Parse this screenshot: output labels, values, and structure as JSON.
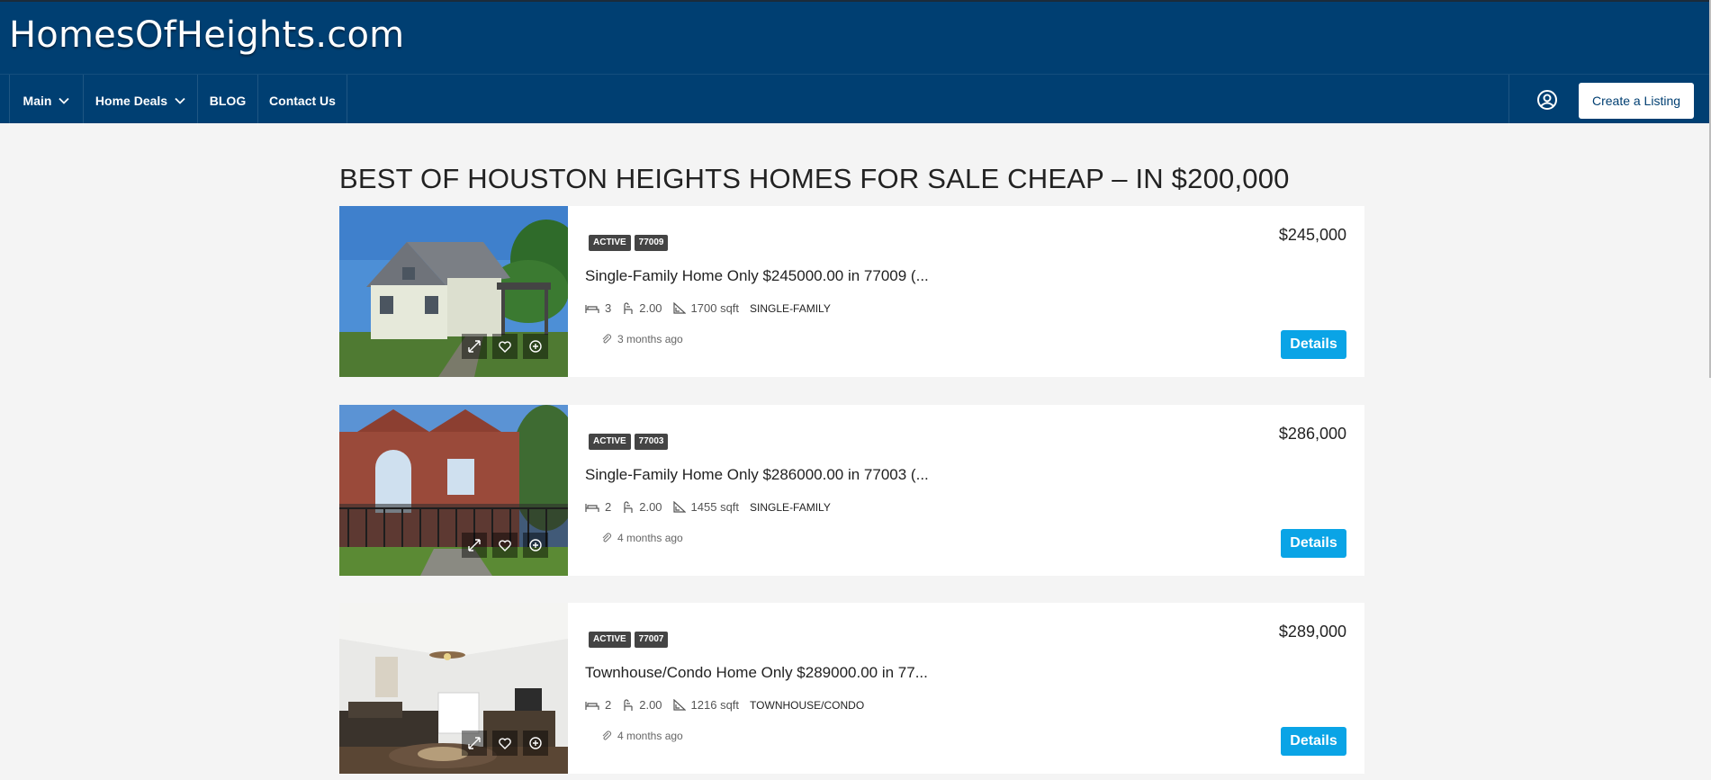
{
  "site": {
    "brand": "HomesOfHeights.com"
  },
  "nav": {
    "items": [
      {
        "label": "Main",
        "dropdown": true
      },
      {
        "label": "Home Deals",
        "dropdown": true
      },
      {
        "label": "BLOG",
        "dropdown": false
      },
      {
        "label": "Contact Us",
        "dropdown": false
      }
    ],
    "create_listing": "Create a Listing"
  },
  "page": {
    "title": "BEST OF HOUSTON HEIGHTS HOMES FOR SALE CHEAP – IN $200,000"
  },
  "listings": [
    {
      "status": "ACTIVE",
      "zip": "77009",
      "title": "Single-Family Home Only $245000.00 in 77009 (...",
      "beds": "3",
      "baths": "2.00",
      "sqft": "1700 sqft",
      "type": "SINGLE-FAMILY",
      "posted": "3 months ago",
      "price": "$245,000",
      "details": "Details"
    },
    {
      "status": "ACTIVE",
      "zip": "77003",
      "title": "Single-Family Home Only $286000.00 in 77003 (...",
      "beds": "2",
      "baths": "2.00",
      "sqft": "1455 sqft",
      "type": "SINGLE-FAMILY",
      "posted": "4 months ago",
      "price": "$286,000",
      "details": "Details"
    },
    {
      "status": "ACTIVE",
      "zip": "77007",
      "title": "Townhouse/Condo Home Only $289000.00 in 77...",
      "beds": "2",
      "baths": "2.00",
      "sqft": "1216 sqft",
      "type": "TOWNHOUSE/CONDO",
      "posted": "4 months ago",
      "price": "$289,000",
      "details": "Details"
    }
  ],
  "colors": {
    "header": "#003f72",
    "accent": "#0aa4e6",
    "badge": "#444444"
  },
  "icons": [
    "chevron-down-icon",
    "user-circle-icon",
    "expand-icon",
    "heart-icon",
    "plus-circle-icon",
    "bed-icon",
    "bath-icon",
    "area-icon",
    "paperclip-icon"
  ]
}
